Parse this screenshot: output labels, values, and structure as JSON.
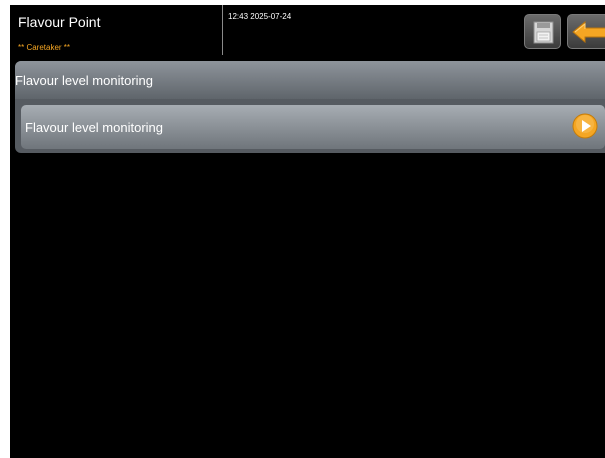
{
  "header": {
    "app_title": "Flavour Point",
    "role": "** Caretaker **",
    "datetime": "12:43 2025-07-24"
  },
  "toolbar": {
    "save_icon": "floppy-save-icon",
    "back_icon": "back-arrow-icon"
  },
  "panel": {
    "title": "Flavour level monitoring",
    "items": [
      {
        "label": "Flavour level monitoring",
        "icon": "play-arrow-icon"
      }
    ]
  },
  "colors": {
    "background": "#000000",
    "accent": "#f5a623",
    "panel": "#565b61",
    "text": "#ffffff"
  }
}
